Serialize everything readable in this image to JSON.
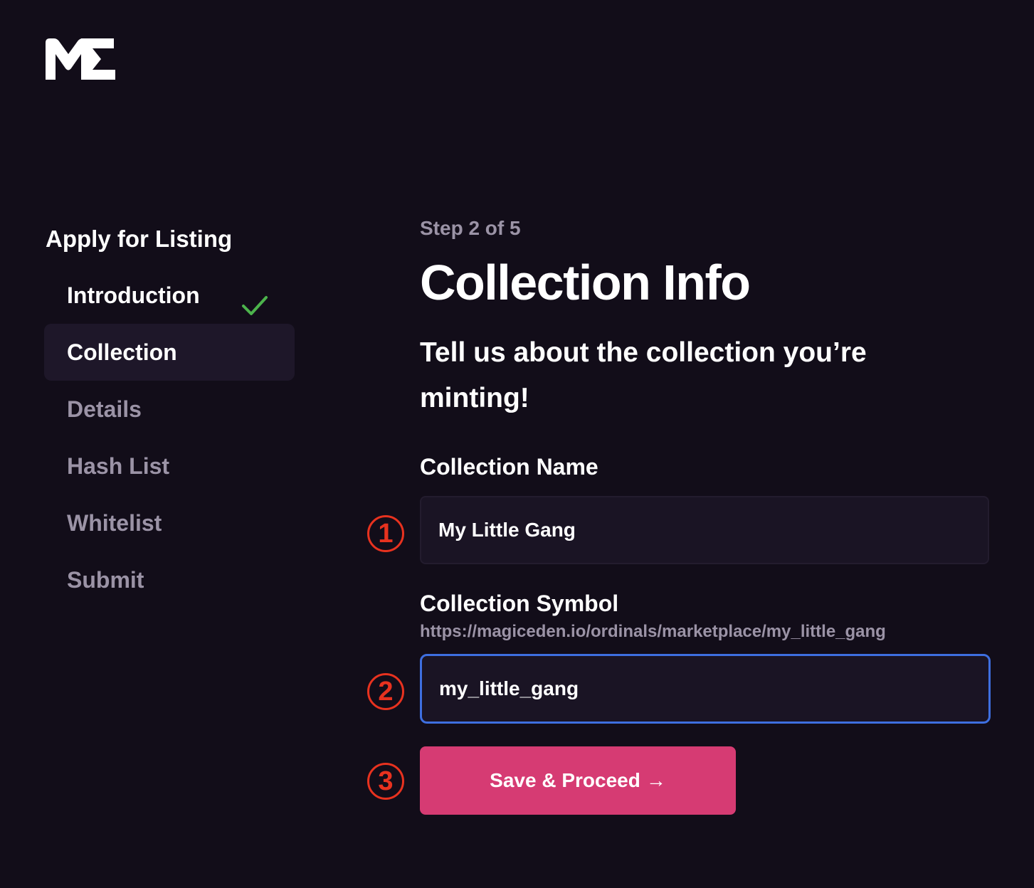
{
  "brand": {
    "logo_icon": "magic-eden-logo-icon",
    "accent_color": "#d63b73",
    "focus_color": "#3e6fe0",
    "background_color": "#120d19",
    "success_color": "#4cb34c",
    "marker_color": "#e8321f"
  },
  "sidebar": {
    "title": "Apply for Listing",
    "items": [
      {
        "label": "Introduction",
        "state": "completed",
        "icon": "check-icon"
      },
      {
        "label": "Collection",
        "state": "active"
      },
      {
        "label": "Details",
        "state": "pending"
      },
      {
        "label": "Hash List",
        "state": "pending"
      },
      {
        "label": "Whitelist",
        "state": "pending"
      },
      {
        "label": "Submit",
        "state": "pending"
      }
    ]
  },
  "main": {
    "step_label": "Step 2 of 5",
    "title": "Collection Info",
    "subtitle": "Tell us about the collection you’re minting!",
    "collection_name": {
      "label": "Collection Name",
      "value": "My Little Gang"
    },
    "collection_symbol": {
      "label": "Collection Symbol",
      "url_hint": "https://magiceden.io/ordinals/marketplace/my_little_gang",
      "value": "my_little_gang"
    },
    "save_button": {
      "label": "Save & Proceed",
      "arrow": "→"
    }
  },
  "annotations": {
    "markers": [
      "1",
      "2",
      "3"
    ]
  }
}
